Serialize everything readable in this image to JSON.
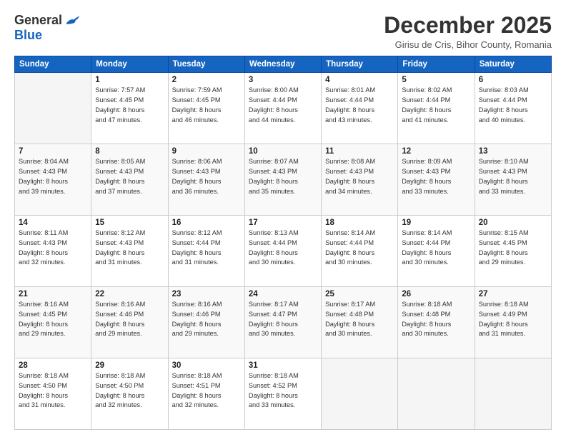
{
  "logo": {
    "general": "General",
    "blue": "Blue"
  },
  "title": "December 2025",
  "subtitle": "Girisu de Cris, Bihor County, Romania",
  "days_header": [
    "Sunday",
    "Monday",
    "Tuesday",
    "Wednesday",
    "Thursday",
    "Friday",
    "Saturday"
  ],
  "weeks": [
    [
      {
        "day": "",
        "info": ""
      },
      {
        "day": "1",
        "info": "Sunrise: 7:57 AM\nSunset: 4:45 PM\nDaylight: 8 hours\nand 47 minutes."
      },
      {
        "day": "2",
        "info": "Sunrise: 7:59 AM\nSunset: 4:45 PM\nDaylight: 8 hours\nand 46 minutes."
      },
      {
        "day": "3",
        "info": "Sunrise: 8:00 AM\nSunset: 4:44 PM\nDaylight: 8 hours\nand 44 minutes."
      },
      {
        "day": "4",
        "info": "Sunrise: 8:01 AM\nSunset: 4:44 PM\nDaylight: 8 hours\nand 43 minutes."
      },
      {
        "day": "5",
        "info": "Sunrise: 8:02 AM\nSunset: 4:44 PM\nDaylight: 8 hours\nand 41 minutes."
      },
      {
        "day": "6",
        "info": "Sunrise: 8:03 AM\nSunset: 4:44 PM\nDaylight: 8 hours\nand 40 minutes."
      }
    ],
    [
      {
        "day": "7",
        "info": "Sunrise: 8:04 AM\nSunset: 4:43 PM\nDaylight: 8 hours\nand 39 minutes."
      },
      {
        "day": "8",
        "info": "Sunrise: 8:05 AM\nSunset: 4:43 PM\nDaylight: 8 hours\nand 37 minutes."
      },
      {
        "day": "9",
        "info": "Sunrise: 8:06 AM\nSunset: 4:43 PM\nDaylight: 8 hours\nand 36 minutes."
      },
      {
        "day": "10",
        "info": "Sunrise: 8:07 AM\nSunset: 4:43 PM\nDaylight: 8 hours\nand 35 minutes."
      },
      {
        "day": "11",
        "info": "Sunrise: 8:08 AM\nSunset: 4:43 PM\nDaylight: 8 hours\nand 34 minutes."
      },
      {
        "day": "12",
        "info": "Sunrise: 8:09 AM\nSunset: 4:43 PM\nDaylight: 8 hours\nand 33 minutes."
      },
      {
        "day": "13",
        "info": "Sunrise: 8:10 AM\nSunset: 4:43 PM\nDaylight: 8 hours\nand 33 minutes."
      }
    ],
    [
      {
        "day": "14",
        "info": "Sunrise: 8:11 AM\nSunset: 4:43 PM\nDaylight: 8 hours\nand 32 minutes."
      },
      {
        "day": "15",
        "info": "Sunrise: 8:12 AM\nSunset: 4:43 PM\nDaylight: 8 hours\nand 31 minutes."
      },
      {
        "day": "16",
        "info": "Sunrise: 8:12 AM\nSunset: 4:44 PM\nDaylight: 8 hours\nand 31 minutes."
      },
      {
        "day": "17",
        "info": "Sunrise: 8:13 AM\nSunset: 4:44 PM\nDaylight: 8 hours\nand 30 minutes."
      },
      {
        "day": "18",
        "info": "Sunrise: 8:14 AM\nSunset: 4:44 PM\nDaylight: 8 hours\nand 30 minutes."
      },
      {
        "day": "19",
        "info": "Sunrise: 8:14 AM\nSunset: 4:44 PM\nDaylight: 8 hours\nand 30 minutes."
      },
      {
        "day": "20",
        "info": "Sunrise: 8:15 AM\nSunset: 4:45 PM\nDaylight: 8 hours\nand 29 minutes."
      }
    ],
    [
      {
        "day": "21",
        "info": "Sunrise: 8:16 AM\nSunset: 4:45 PM\nDaylight: 8 hours\nand 29 minutes."
      },
      {
        "day": "22",
        "info": "Sunrise: 8:16 AM\nSunset: 4:46 PM\nDaylight: 8 hours\nand 29 minutes."
      },
      {
        "day": "23",
        "info": "Sunrise: 8:16 AM\nSunset: 4:46 PM\nDaylight: 8 hours\nand 29 minutes."
      },
      {
        "day": "24",
        "info": "Sunrise: 8:17 AM\nSunset: 4:47 PM\nDaylight: 8 hours\nand 30 minutes."
      },
      {
        "day": "25",
        "info": "Sunrise: 8:17 AM\nSunset: 4:48 PM\nDaylight: 8 hours\nand 30 minutes."
      },
      {
        "day": "26",
        "info": "Sunrise: 8:18 AM\nSunset: 4:48 PM\nDaylight: 8 hours\nand 30 minutes."
      },
      {
        "day": "27",
        "info": "Sunrise: 8:18 AM\nSunset: 4:49 PM\nDaylight: 8 hours\nand 31 minutes."
      }
    ],
    [
      {
        "day": "28",
        "info": "Sunrise: 8:18 AM\nSunset: 4:50 PM\nDaylight: 8 hours\nand 31 minutes."
      },
      {
        "day": "29",
        "info": "Sunrise: 8:18 AM\nSunset: 4:50 PM\nDaylight: 8 hours\nand 32 minutes."
      },
      {
        "day": "30",
        "info": "Sunrise: 8:18 AM\nSunset: 4:51 PM\nDaylight: 8 hours\nand 32 minutes."
      },
      {
        "day": "31",
        "info": "Sunrise: 8:18 AM\nSunset: 4:52 PM\nDaylight: 8 hours\nand 33 minutes."
      },
      {
        "day": "",
        "info": ""
      },
      {
        "day": "",
        "info": ""
      },
      {
        "day": "",
        "info": ""
      }
    ]
  ]
}
